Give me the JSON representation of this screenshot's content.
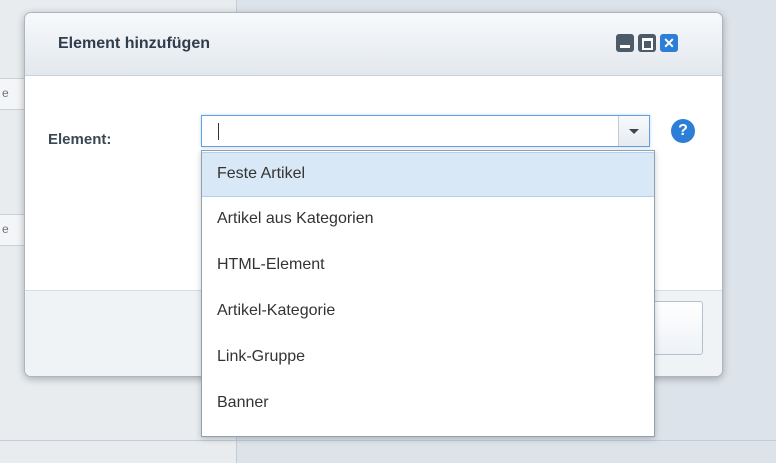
{
  "background": {
    "stub_glyphs": [
      "e",
      "e"
    ]
  },
  "dialog": {
    "title": "Element hinzufügen",
    "window_buttons": {
      "minimize_icon": "minimize-icon",
      "maximize_icon": "maximize-icon",
      "close_icon": "close-icon",
      "close_glyph": "✕"
    },
    "field_label": "Element:",
    "input_value": "",
    "help_glyph": "?",
    "dropdown_options": [
      "Feste Artikel",
      "Artikel aus Kategorien",
      "HTML-Element",
      "Artikel-Kategorie",
      "Link-Gruppe",
      "Banner"
    ],
    "highlighted_option": "Feste Artikel"
  },
  "colors": {
    "accent": "#2c7ed6",
    "focus_border": "#62a0e6",
    "highlight": "#d9e8f7"
  }
}
